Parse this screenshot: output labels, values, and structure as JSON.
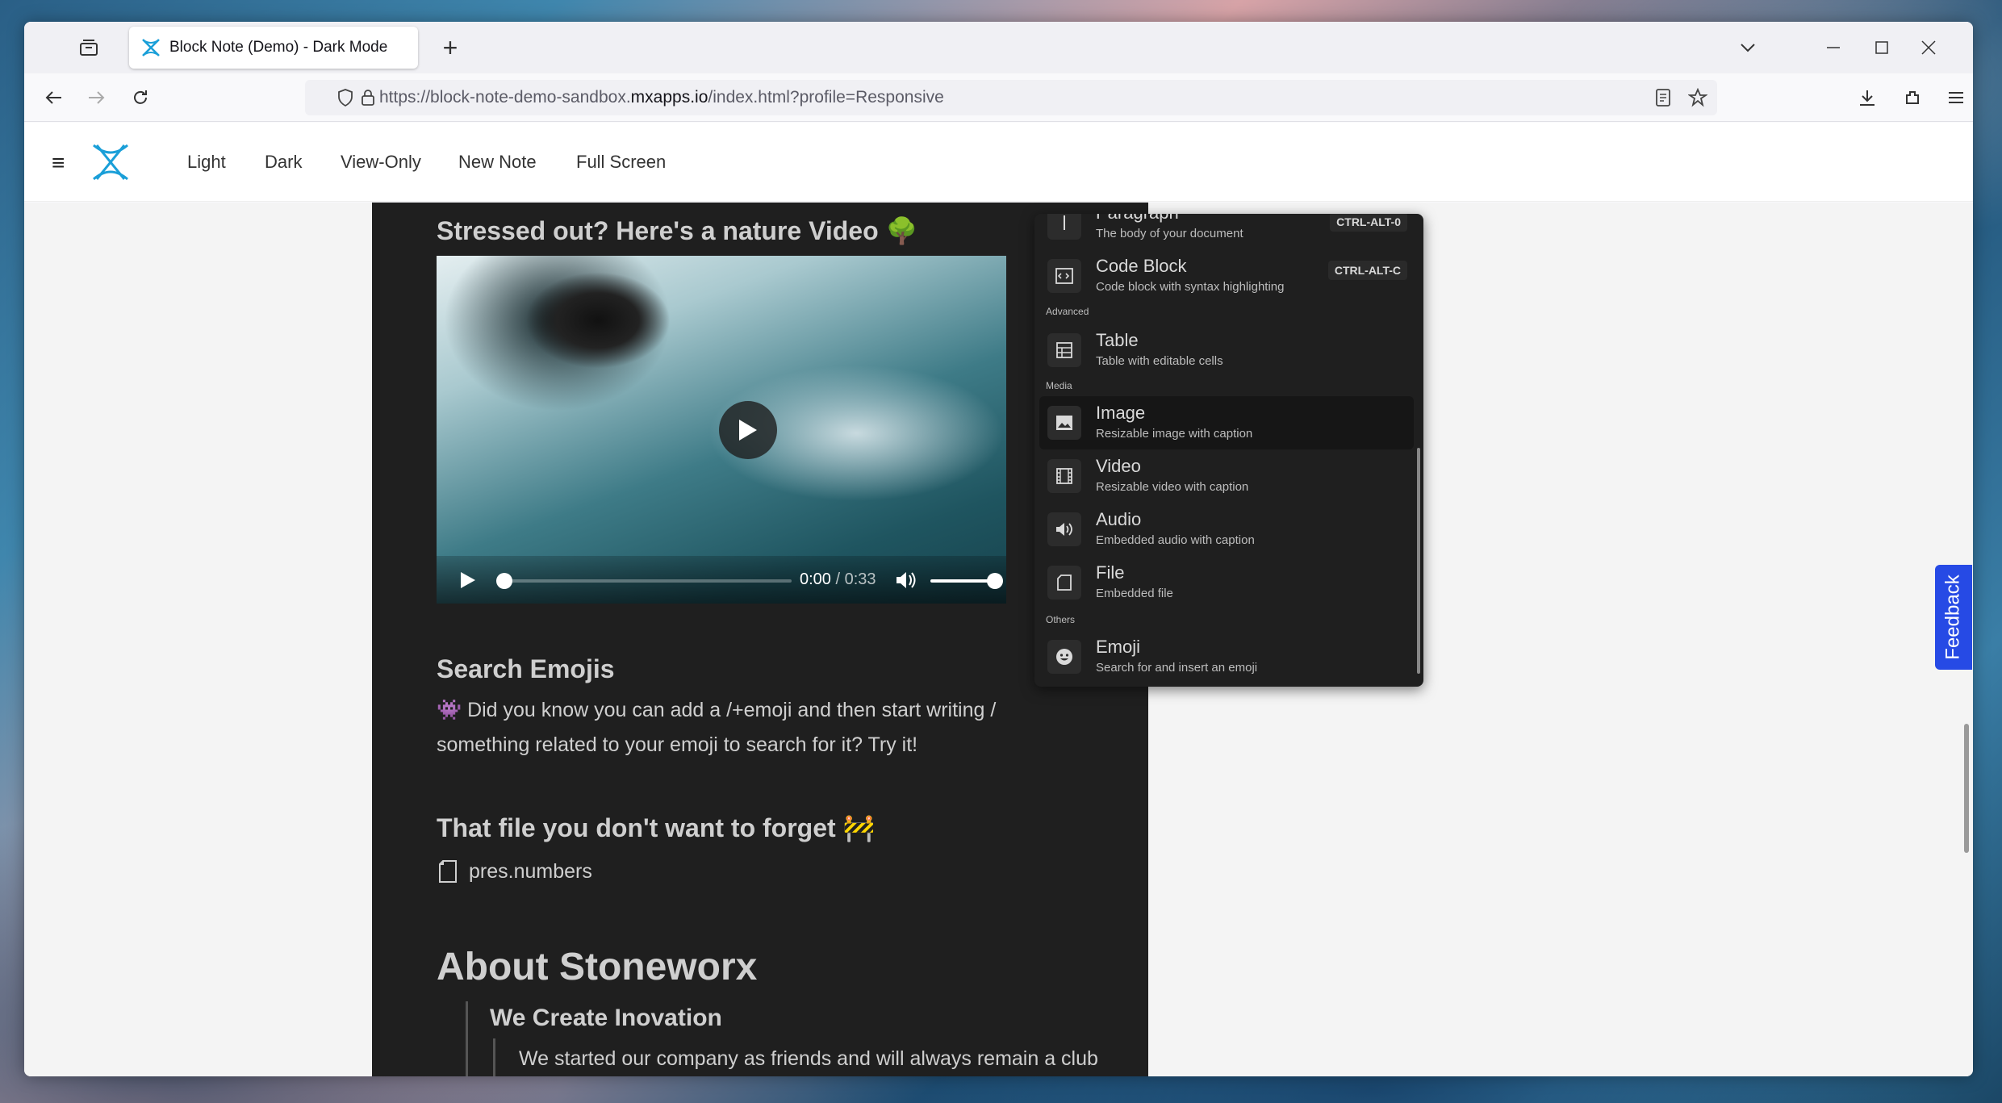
{
  "browser": {
    "tab_title": "Block Note (Demo) - Dark Mode",
    "url_prefix": "https://block-note-demo-sandbox.",
    "url_domain": "mxapps.io",
    "url_suffix": "/index.html?profile=Responsive"
  },
  "app": {
    "menu": [
      "Light",
      "Dark",
      "View-Only",
      "New Note",
      "Full Screen"
    ],
    "brand_color": "#1a9fd8"
  },
  "editor": {
    "video_heading": "Stressed out? Here's a nature Video 🌳",
    "video_time_current": "0:00",
    "video_time_duration": "0:33",
    "emoji_heading": "Search Emojis",
    "emoji_text": "👾 Did you know you can add a /+emoji and then start writing / something related to your emoji to search for it? Try it!",
    "file_heading": "That file you don't want to forget 🚧",
    "file_name": "pres.numbers",
    "about_heading": "About Stoneworx",
    "create_heading": "We Create Inovation",
    "create_text": "We started our company as friends and will always remain a club of people that likes doing business in a friendly matter."
  },
  "slash_menu": {
    "items": [
      {
        "title": "Paragraph",
        "subtitle": "The body of your document",
        "shortcut": "CTRL-ALT-0",
        "icon": "paragraph-icon"
      },
      {
        "title": "Code Block",
        "subtitle": "Code block with syntax highlighting",
        "shortcut": "CTRL-ALT-C",
        "icon": "code-icon"
      },
      {
        "title": "Table",
        "subtitle": "Table with editable cells",
        "icon": "table-icon"
      },
      {
        "title": "Image",
        "subtitle": "Resizable image with caption",
        "icon": "image-icon"
      },
      {
        "title": "Video",
        "subtitle": "Resizable video with caption",
        "icon": "film-icon"
      },
      {
        "title": "Audio",
        "subtitle": "Embedded audio with caption",
        "icon": "speaker-icon"
      },
      {
        "title": "File",
        "subtitle": "Embedded file",
        "icon": "file-icon"
      },
      {
        "title": "Emoji",
        "subtitle": "Search for and insert an emoji",
        "icon": "smiley-icon"
      }
    ],
    "groups": {
      "advanced": "Advanced",
      "media": "Media",
      "others": "Others"
    }
  },
  "feedback_label": "Feedback"
}
